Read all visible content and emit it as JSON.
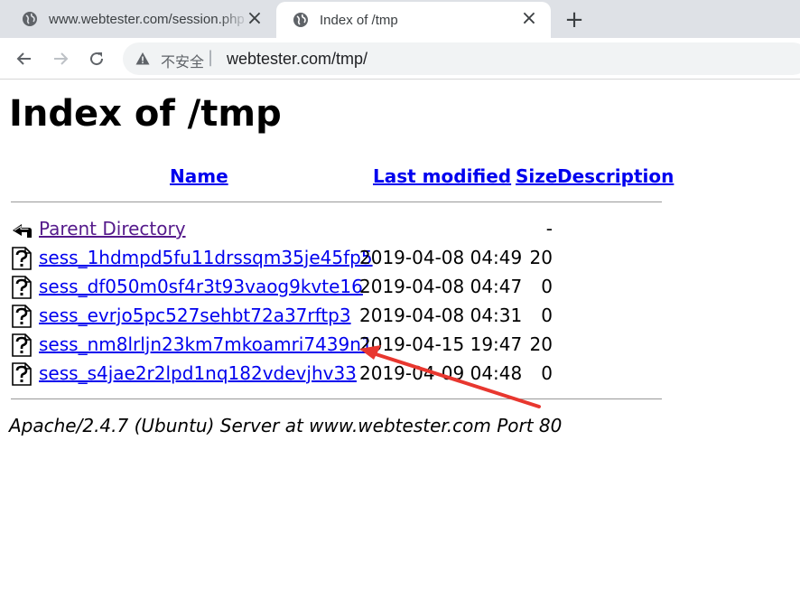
{
  "browser": {
    "tabs": [
      {
        "title": "www.webtester.com/session.php",
        "close": "×"
      },
      {
        "title": "Index of /tmp",
        "close": "×"
      }
    ],
    "new_tab": "+",
    "security_label": "不安全",
    "separator": "|",
    "url": "webtester.com/tmp/"
  },
  "page": {
    "title": "Index of /tmp",
    "columns": {
      "name": "Name",
      "last_modified": "Last modified",
      "size": "Size",
      "description": "Description"
    },
    "parent": {
      "name": "Parent Directory",
      "size": "-"
    },
    "files": [
      {
        "name": "sess_1hdmpd5fu11drssqm35je45fp5",
        "modified": "2019-04-08 04:49",
        "size": "20"
      },
      {
        "name": "sess_df050m0sf4r3t93vaog9kvte16",
        "modified": "2019-04-08 04:47",
        "size": "0"
      },
      {
        "name": "sess_evrjo5pc527sehbt72a37rftp3",
        "modified": "2019-04-08 04:31",
        "size": "0"
      },
      {
        "name": "sess_nm8lrljn23km7mkoamri7439n1",
        "modified": "2019-04-15 19:47",
        "size": "20"
      },
      {
        "name": "sess_s4jae2r2lpd1nq182vdevjhv33",
        "modified": "2019-04-09 04:48",
        "size": "0"
      }
    ],
    "server_signature": "Apache/2.4.7 (Ubuntu) Server at www.webtester.com Port 80"
  },
  "annotation": {
    "color": "#e8372f"
  }
}
